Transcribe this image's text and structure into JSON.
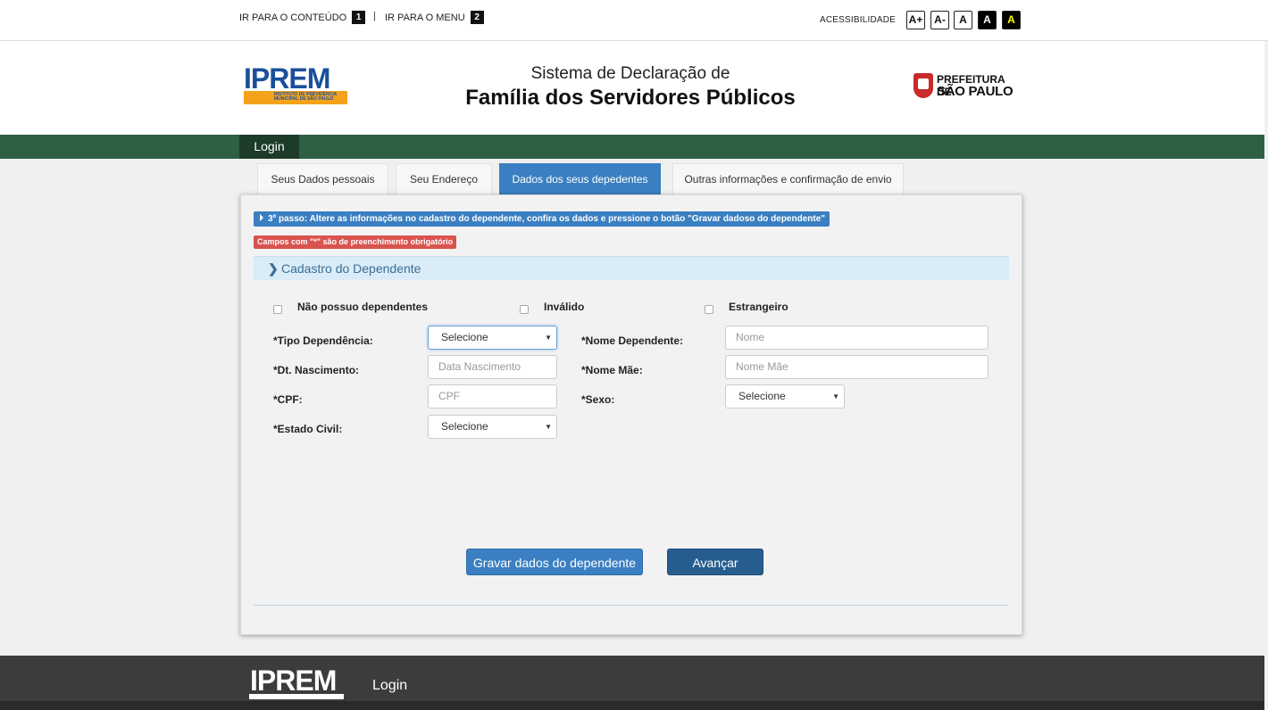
{
  "skip_links": [
    {
      "label": "IR PARA O CONTEÚDO",
      "key": "1"
    },
    {
      "label": "IR PARA O MENU",
      "key": "2"
    }
  ],
  "skip_separator": "|",
  "accessibility": {
    "label": "ACESSIBILIDADE",
    "buttons": [
      "A+",
      "A-",
      "A",
      "A",
      "A"
    ]
  },
  "header": {
    "logo_text": "IPREM",
    "logo_subtext": "INSTITUTO DE PREVIDÊNCIA MUNICIPAL DE SÃO PAULO",
    "title_line1": "Sistema de Declaração de",
    "title_line2": "Família dos Servidores Públicos",
    "prefeitura_line1": "PREFEITURA DE",
    "prefeitura_line2": "SÃO PAULO"
  },
  "nav": {
    "login": "Login"
  },
  "tabs": [
    {
      "label": "Seus Dados pessoais",
      "active": false
    },
    {
      "label": "Seu Endereço",
      "active": false
    },
    {
      "label": "Dados dos seus depedentes",
      "active": true
    },
    {
      "label": "Outras informações e confirmação de envio",
      "active": false
    }
  ],
  "step_badge": "3º passo: Altere as informações no cadastro do dependente, confira os dados e pressione o botão \"Gravar dadoso do dependente\"",
  "required_badge": "Campos com \"*\" são de preenchimento obrigatório",
  "section_title": "Cadastro do Dependente",
  "checkboxes": {
    "no_dependents": "Não possuo dependentes",
    "invalid": "Inválido",
    "foreigner": "Estrangeiro"
  },
  "form": {
    "tipo_label": "*Tipo Dependência:",
    "tipo_value": "Selecione",
    "nome_label": "*Nome Dependente:",
    "nome_placeholder": "Nome",
    "nasc_label": "*Dt. Nascimento:",
    "nasc_placeholder": "Data Nascimento",
    "mae_label": "*Nome Mãe:",
    "mae_placeholder": "Nome Mãe",
    "cpf_label": "*CPF:",
    "cpf_placeholder": "CPF",
    "sexo_label": "*Sexo:",
    "sexo_value": "Selecione",
    "civil_label": "*Estado Civil:",
    "civil_value": "Selecione"
  },
  "buttons": {
    "save": "Gravar dados do dependente",
    "next": "Avançar"
  },
  "footer": {
    "logo_text": "IPREM",
    "login": "Login"
  },
  "colors": {
    "nav_green": "#2e6044",
    "accent_blue": "#3a7fc1",
    "required_red": "#d9534f"
  }
}
